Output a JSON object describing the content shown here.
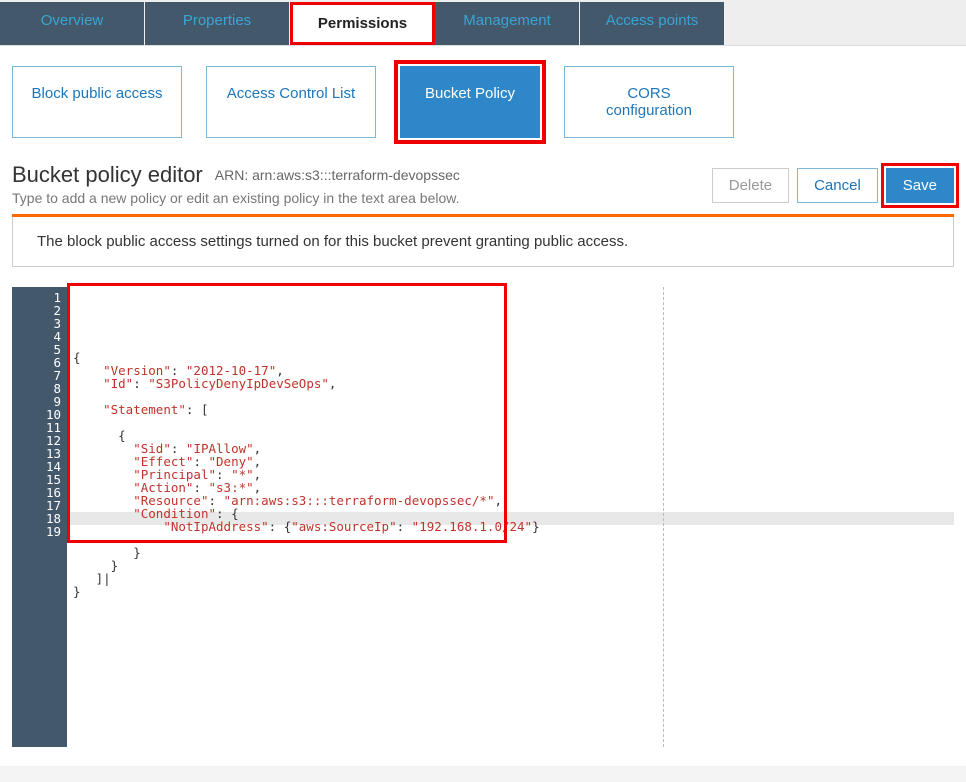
{
  "tabs": {
    "overview": "Overview",
    "properties": "Properties",
    "permissions": "Permissions",
    "management": "Management",
    "access_points": "Access points"
  },
  "sub_tabs": {
    "block_public": "Block public access",
    "acl": "Access Control List",
    "bucket_policy": "Bucket Policy",
    "cors": "CORS configuration"
  },
  "editor": {
    "title": "Bucket policy editor",
    "arn_label": "ARN:",
    "arn_value": "arn:aws:s3:::terraform-devopssec",
    "subtitle": "Type to add a new policy or edit an existing policy in the text area below."
  },
  "buttons": {
    "delete": "Delete",
    "cancel": "Cancel",
    "save": "Save"
  },
  "warning": "The block public access settings turned on for this bucket prevent granting public access.",
  "code": {
    "line_count": 19,
    "highlighted_line_index": 18,
    "policy_json": {
      "Version": "2012-10-17",
      "Id": "S3PolicyDenyIpDevSeOps",
      "Statement": [
        {
          "Sid": "IPAllow",
          "Effect": "Deny",
          "Principal": "*",
          "Action": "s3:*",
          "Resource": "arn:aws:s3:::terraform-devopssec/*",
          "Condition": {
            "NotIpAddress": {
              "aws:SourceIp": "192.168.1.0/24"
            }
          }
        }
      ]
    },
    "raw_lines": [
      "{",
      "    \"Version\": \"2012-10-17\",",
      "    \"Id\": \"S3PolicyDenyIpDevSeOps\",",
      "",
      "    \"Statement\": [",
      "",
      "      {",
      "        \"Sid\": \"IPAllow\",",
      "        \"Effect\": \"Deny\",",
      "        \"Principal\": \"*\",",
      "        \"Action\": \"s3:*\",",
      "        \"Resource\": \"arn:aws:s3:::terraform-devopssec/*\",",
      "        \"Condition\": {",
      "            \"NotIpAddress\": {\"aws:SourceIp\": \"192.168.1.0/24\"}",
      "",
      "        }",
      "     }",
      "   ]|",
      "}"
    ]
  }
}
